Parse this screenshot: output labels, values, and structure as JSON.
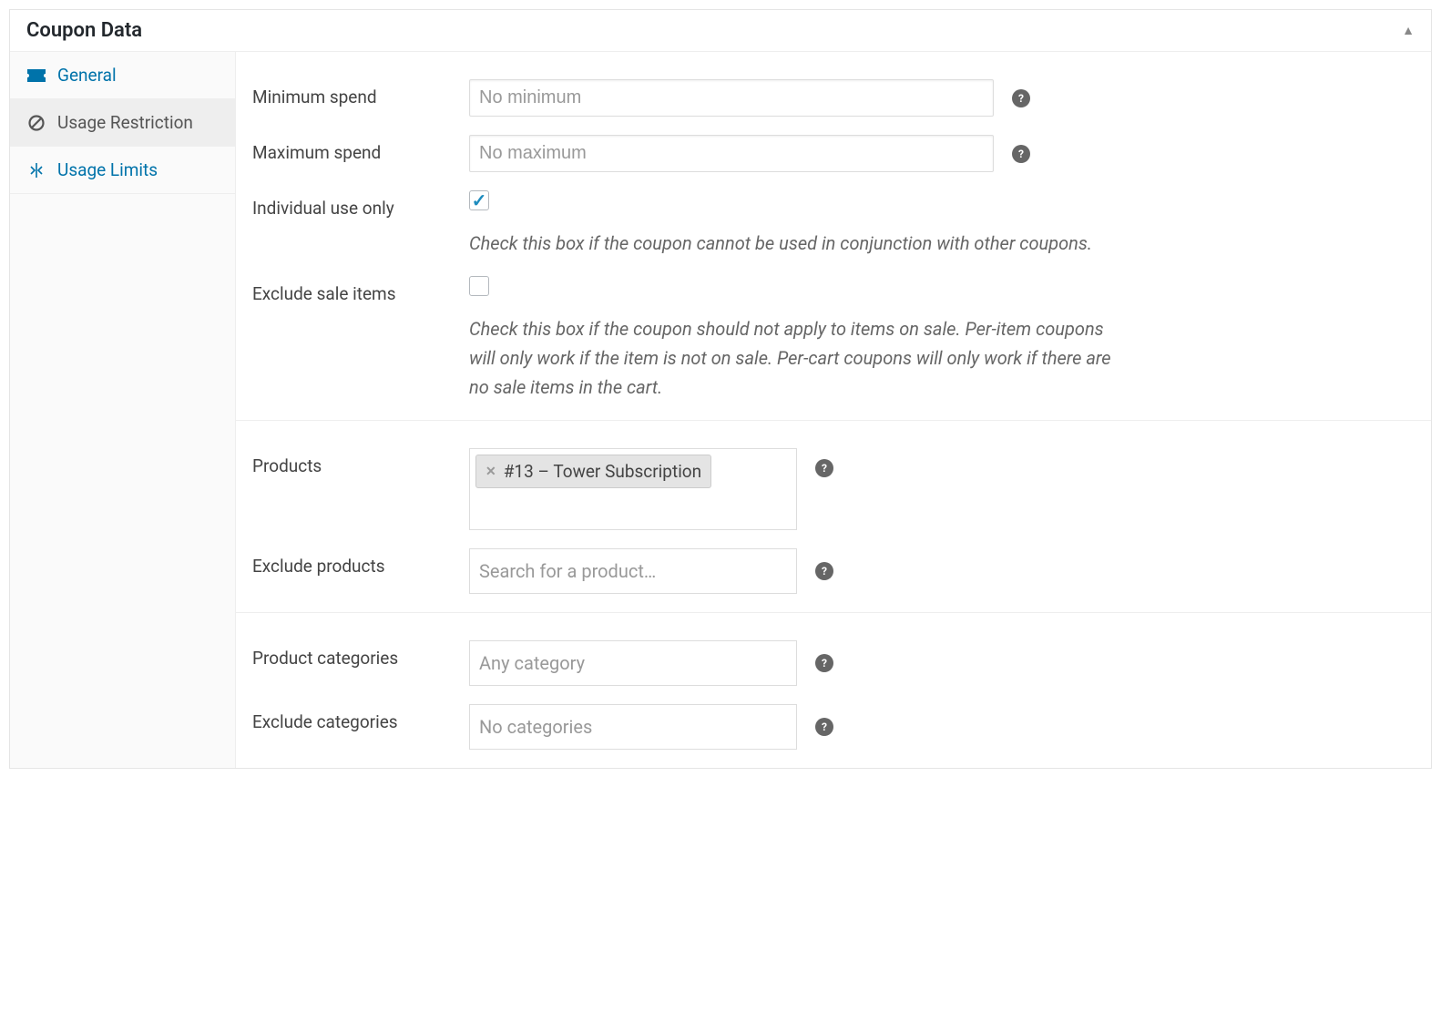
{
  "header": {
    "title": "Coupon Data"
  },
  "tabs": {
    "general": {
      "label": "General"
    },
    "usage_restriction": {
      "label": "Usage Restriction"
    },
    "usage_limits": {
      "label": "Usage Limits"
    }
  },
  "fields": {
    "min_spend": {
      "label": "Minimum spend",
      "placeholder": "No minimum"
    },
    "max_spend": {
      "label": "Maximum spend",
      "placeholder": "No maximum"
    },
    "individual_use": {
      "label": "Individual use only",
      "description": "Check this box if the coupon cannot be used in conjunction with other coupons."
    },
    "exclude_sale": {
      "label": "Exclude sale items",
      "description": "Check this box if the coupon should not apply to items on sale. Per-item coupons will only work if the item is not on sale. Per-cart coupons will only work if there are no sale items in the cart."
    },
    "products": {
      "label": "Products",
      "selected": "#13 – Tower Subscription"
    },
    "exclude_products": {
      "label": "Exclude products",
      "placeholder": "Search for a product…"
    },
    "product_categories": {
      "label": "Product categories",
      "placeholder": "Any category"
    },
    "exclude_categories": {
      "label": "Exclude categories",
      "placeholder": "No categories"
    }
  }
}
